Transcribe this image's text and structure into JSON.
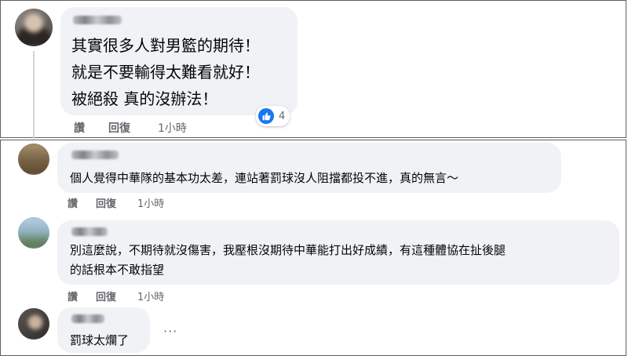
{
  "comments": [
    {
      "lines": [
        "其實很多人對男籃的期待！",
        "就是不要輸得太難看就好！",
        "被絕殺 真的沒辦法！"
      ],
      "like_label": "讚",
      "reply_label": "回復",
      "time": "1小時",
      "reaction_icon": "like-icon",
      "reaction_count": "4"
    },
    {
      "lines": [
        "個人覺得中華隊的基本功太差，連站著罰球沒人阻擋都投不進，真的無言～"
      ],
      "like_label": "讚",
      "reply_label": "回復",
      "time": "1小時"
    },
    {
      "lines": [
        "別這麼說，不期待就沒傷害，我壓根沒期待中華能打出好成績，有這種體協在扯後腿",
        "的話根本不敢指望"
      ],
      "like_label": "讚",
      "reply_label": "回復",
      "time": "1小時"
    },
    {
      "lines": [
        "罰球太爛了"
      ],
      "more_label": "···"
    }
  ],
  "colors": {
    "bubble": "#f0f2f5",
    "action_text": "#65676b",
    "like_blue": "#1877f2"
  }
}
